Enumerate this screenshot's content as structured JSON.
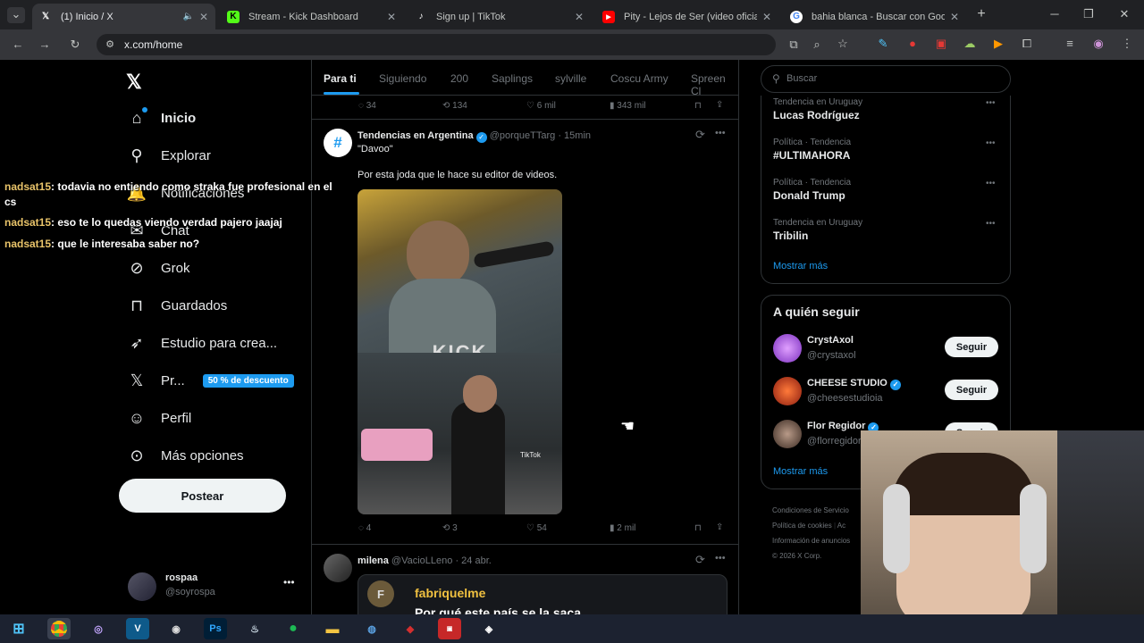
{
  "browser": {
    "tabs": [
      {
        "title": "(1) Inicio / X"
      },
      {
        "title": "Stream - Kick Dashboard"
      },
      {
        "title": "Sign up | TikTok"
      },
      {
        "title": "Pity - Lejos de Ser (video oficial"
      },
      {
        "title": "bahia blanca - Buscar con Goo"
      }
    ],
    "url": "x.com/home"
  },
  "sidebar": {
    "items": [
      {
        "label": "Inicio",
        "icon": "home-icon"
      },
      {
        "label": "Explorar",
        "icon": "search-icon"
      },
      {
        "label": "Notificaciones",
        "icon": "bell-icon"
      },
      {
        "label": "Chat",
        "icon": "chat-icon"
      },
      {
        "label": "Grok",
        "icon": "grok-icon"
      },
      {
        "label": "Guardados",
        "icon": "bookmark-icon"
      },
      {
        "label": "Estudio para crea...",
        "icon": "rocket-icon"
      },
      {
        "label": "Pr...",
        "icon": "x-logo-icon"
      },
      {
        "label": "Perfil",
        "icon": "person-icon"
      },
      {
        "label": "Más opciones",
        "icon": "more-icon"
      }
    ],
    "premium_badge": "50 % de descuento",
    "post_button": "Postear",
    "account": {
      "name": "rospaa",
      "handle": "@soyrospa"
    }
  },
  "chat_overlay": [
    {
      "user": "nadsat15",
      "text": ": todavia no entiendo como straka fue profesional en el cs"
    },
    {
      "user": "nadsat15",
      "text": ": eso te lo quedas viendo verdad pajero jaajaj"
    },
    {
      "user": "nadsat15",
      "text": ": que le interesaba saber no?"
    }
  ],
  "feed": {
    "tabs": [
      "Para ti",
      "Siguiendo",
      "200",
      "Saplings",
      "sylville",
      "Coscu Army",
      "Spreen Cl"
    ],
    "prev_post_stats": {
      "replies": "34",
      "reposts": "134",
      "likes": "6 mil",
      "views": "343 mil"
    },
    "post": {
      "author": "Tendencias en Argentina",
      "handle": "@porqueTTarg",
      "time": "· 15min",
      "title": "\"Davoo\"",
      "text": "Por esta joda que le hace su editor de videos.",
      "media_watermark": "KICK",
      "tiktok_label": "TikTok",
      "stats": {
        "replies": "4",
        "reposts": "3",
        "likes": "54",
        "views": "2 mil"
      }
    },
    "next_post": {
      "author": "milena",
      "handle": "@VacioLLeno",
      "time": "· 24 abr.",
      "quoted_initial": "F",
      "quoted_author": "fabriquelme",
      "quoted_text": "Por qué este país se la saca"
    }
  },
  "right": {
    "search_placeholder": "Buscar",
    "trends": [
      {
        "meta": "Tendencia en Uruguay",
        "name": "Lucas Rodríguez"
      },
      {
        "meta": "Política · Tendencia",
        "name": "#ULTIMAHORA"
      },
      {
        "meta": "Política · Tendencia",
        "name": "Donald Trump"
      },
      {
        "meta": "Tendencia en Uruguay",
        "name": "Tribilin"
      }
    ],
    "show_more": "Mostrar más",
    "who_to_follow_title": "A quién seguir",
    "follow": [
      {
        "name": "CrystAxol",
        "handle": "@crystaxol",
        "button": "Seguir"
      },
      {
        "name": "CHEESE STUDIO",
        "handle": "@cheesestudioia",
        "button": "Seguir"
      },
      {
        "name": "Flor Regidor",
        "handle": "@florregidor",
        "button": "Seguir"
      }
    ],
    "show_more_2": "Mostrar más",
    "footer": [
      "Condiciones de Servicio",
      "Política de cookies",
      "Ac",
      "Información de anuncios",
      "© 2026 X Corp."
    ]
  },
  "colors": {
    "accent": "#1d9bf0",
    "background": "#000000",
    "border": "#2f3336",
    "muted": "#71767b"
  }
}
